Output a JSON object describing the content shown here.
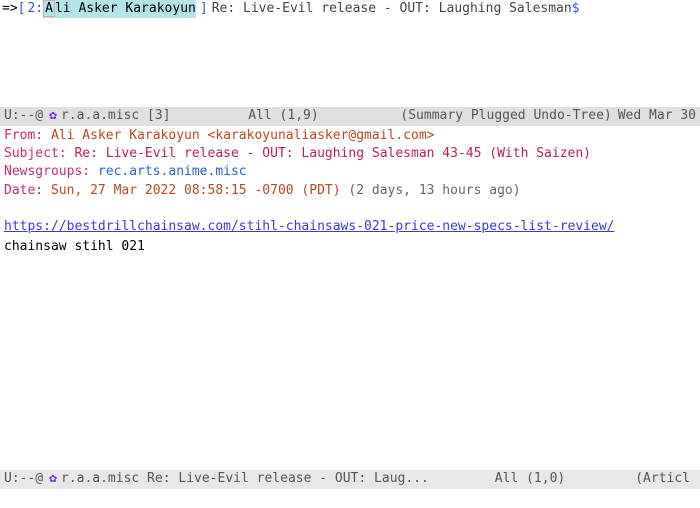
{
  "summary": {
    "row": {
      "marker": "=>",
      "open_bracket": "[",
      "number": "  2:",
      "author_boxed": "A",
      "author_rest": "li Asker Karakoyun   ",
      "close_bracket": "]",
      "subject": "Re: Live-Evil release - OUT: Laughing Salesman",
      "overflow_glyph": "$"
    }
  },
  "modeline_summary": {
    "status": "U:--@",
    "icon": "✿",
    "buffer": "r.a.a.misc [3]",
    "position": "All (1,9)",
    "modes": "(Summary Plugged Undo-Tree)",
    "time": "Wed Mar 30"
  },
  "article": {
    "headers": {
      "from_label": "From:",
      "from_value": "Ali Asker Karakoyun <karakoyunaliasker@gmail.com>",
      "subject_label": "Subject:",
      "subject_value": "Re: Live-Evil release - OUT: Laughing Salesman 43-45 (With Saizen)",
      "newsgroups_label": "Newsgroups:",
      "newsgroups_value": "rec.arts.anime.misc",
      "date_label": "Date:",
      "date_value": "Sun, 27 Mar 2022 08:58:15 -0700 (PDT)",
      "date_age": "(2 days, 13 hours ago)"
    },
    "body": {
      "url": "https://bestdrillchainsaw.com/stihl-chainsaws-021-price-new-specs-list-review/",
      "text": "chainsaw stihl 021"
    }
  },
  "modeline_article": {
    "status": "U:--@",
    "icon": "✿",
    "buffer": "r.a.a.misc Re: Live-Evil release - OUT: Laug...",
    "position": "All (1,0)",
    "modes": "(Articl"
  }
}
